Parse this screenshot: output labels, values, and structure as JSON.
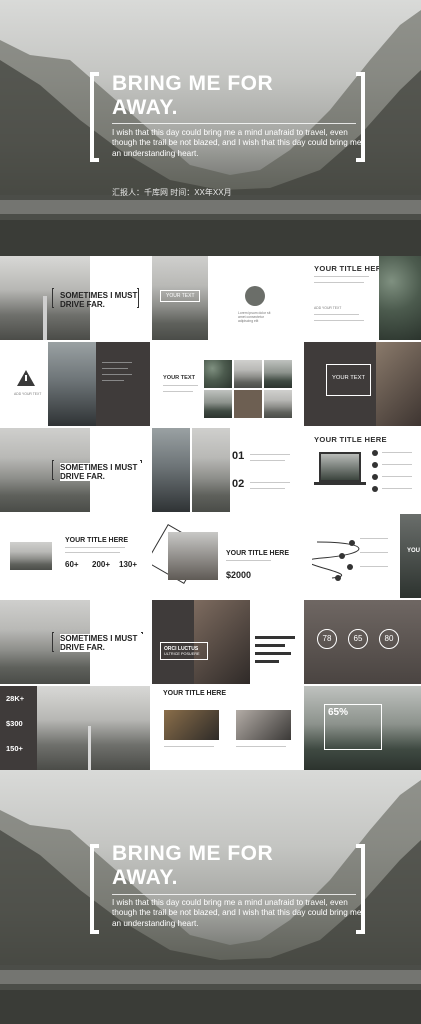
{
  "hero": {
    "title_line1": "BRING ME FOR",
    "title_line2": "AWAY.",
    "body": "I wish that this day could bring me a mind unafraid to travel, even though the trail be not blazed, and I wish that this day could bring me an understanding heart.",
    "meta": "汇报人：千库网 时间：XX年XX月"
  },
  "slides": {
    "r1": {
      "sometimes_1": "SOMETIMES I MUST",
      "sometimes_2": "DRIVE FAR.",
      "your_text": "YOUR TEXT",
      "your_title": "YOUR TITLE HERE",
      "add_text": "ADD YOUR TEXT"
    },
    "r2": {
      "add_text": "ADD YOUR TEXT",
      "your_text": "YOUR TEXT",
      "your_text_box": "YOUR TEXT"
    },
    "r3": {
      "sometimes_1": "SOMETIMES I MUST",
      "sometimes_2": "DRIVE FAR.",
      "num1": "01",
      "num2": "02",
      "your_title": "YOUR TITLE HERE"
    },
    "r4": {
      "your_title": "YOUR  TITLE  HERE",
      "stat1": "60+",
      "stat2": "200+",
      "stat3": "130+",
      "your_title2": "YOUR  TITLE  HERE",
      "price": "$2000",
      "edge_text": "YOU"
    },
    "r5": {
      "sometimes_1": "SOMETIMES I MUST",
      "sometimes_2": "DRIVE FAR.",
      "orci_1": "ORCI LUCTUS",
      "orci_2": "ULTRICE POSUERE",
      "ring1": "78",
      "ring2": "65",
      "ring3": "80"
    },
    "r6": {
      "stat1": "28K+",
      "stat2": "$300",
      "stat3": "150+",
      "your_title": "YOUR  TITLE  HERE",
      "pct": "65%"
    }
  },
  "hero2": {
    "title_line1": "BRING ME FOR",
    "title_line2": "AWAY.",
    "body": "I wish that this day could bring me a mind unafraid to travel, even though the trail be not blazed, and I wish that this day could bring me an understanding heart."
  }
}
